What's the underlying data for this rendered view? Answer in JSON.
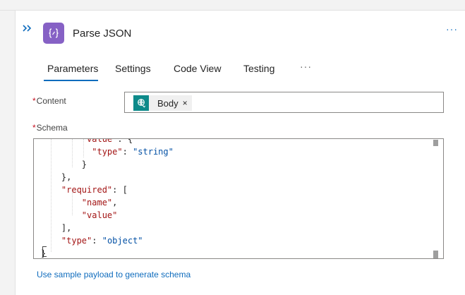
{
  "header": {
    "title": "Parse JSON",
    "more_label": "···",
    "accent": "#8661c5",
    "icon": "braces-icon",
    "collapse_icon": "double-chevron-right-icon"
  },
  "tabs": [
    {
      "label": "Parameters",
      "active": true
    },
    {
      "label": "Settings",
      "active": false
    },
    {
      "label": "Code View",
      "active": false
    },
    {
      "label": "Testing",
      "active": false
    }
  ],
  "tabs_more_label": "···",
  "fields": {
    "content": {
      "required_mark": "*",
      "label": "Content",
      "token": {
        "label": "Body",
        "remove": "×",
        "icon": "http-request-icon",
        "color": "#0d8a8a"
      }
    },
    "schema": {
      "required_mark": "*",
      "label": "Schema",
      "code_lines": [
        "    \"value\": {",
        "        \"type\": \"string\"",
        "    }",
        "},",
        "\"required\": [",
        "    \"name\",",
        "    \"value\"",
        "],",
        "\"type\": \"object\"",
        "}"
      ]
    }
  },
  "sample_payload_link": "Use sample payload to generate schema"
}
